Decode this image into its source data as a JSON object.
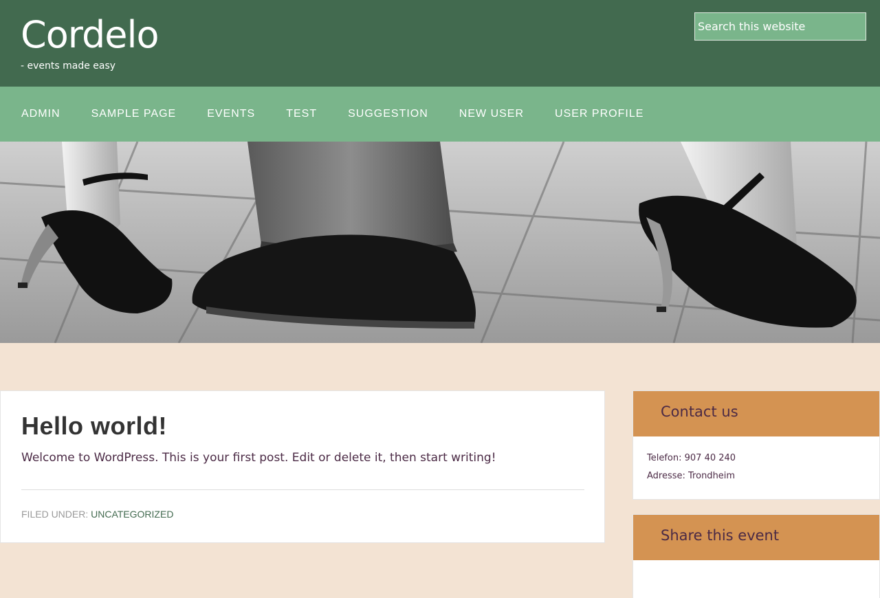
{
  "site": {
    "title": "Cordelo",
    "description": "- events made easy"
  },
  "search": {
    "placeholder": "Search this website"
  },
  "nav": {
    "items": [
      {
        "label": "ADMIN"
      },
      {
        "label": "SAMPLE PAGE"
      },
      {
        "label": "EVENTS"
      },
      {
        "label": "TEST"
      },
      {
        "label": "SUGGESTION"
      },
      {
        "label": "NEW USER"
      },
      {
        "label": "USER PROFILE"
      }
    ]
  },
  "post": {
    "title": "Hello world!",
    "body": "Welcome to WordPress. This is your first post. Edit or delete it, then start writing!",
    "meta_label": "FILED UNDER:",
    "category": "UNCATEGORIZED"
  },
  "sidebar": {
    "contact": {
      "title": "Contact us",
      "phone": "Telefon: 907 40 240",
      "address": "Adresse: Trondheim"
    },
    "share": {
      "title": "Share this event"
    }
  },
  "colors": {
    "header_bg": "#426a4f",
    "nav_bg": "#7ab58b",
    "page_bg": "#f3e3d3",
    "widget_head": "#d49352",
    "text_purple": "#4b2a45"
  },
  "hero_image": "dancing-shoes-banner"
}
